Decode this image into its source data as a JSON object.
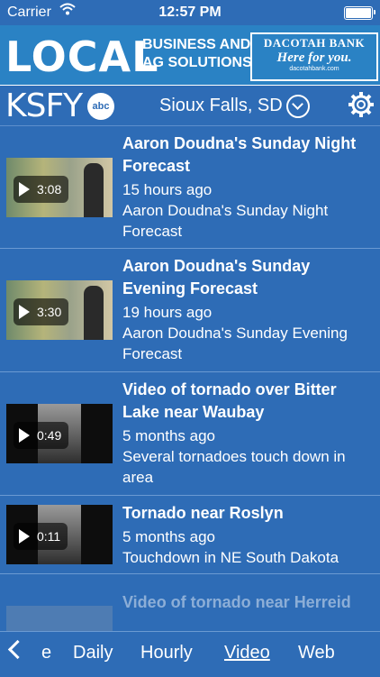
{
  "status": {
    "carrier": "Carrier",
    "time": "12:57 PM"
  },
  "ad": {
    "big": "LOCAL",
    "line1": "BUSINESS AND",
    "line2": "AG SOLUTIONS",
    "bank": "DACOTAH BANK",
    "slogan": "Here for you.",
    "url": "dacotahbank.com"
  },
  "header": {
    "logo": "KSFY",
    "network": "abc",
    "location": "Sioux Falls, SD"
  },
  "videos": [
    {
      "title": "Aaron Doudna's Sunday Night Forecast",
      "age": "15 hours ago",
      "desc": "Aaron Doudna's Sunday Night Forecast",
      "duration": "3:08"
    },
    {
      "title": "Aaron Doudna's Sunday Evening Forecast",
      "age": "19 hours ago",
      "desc": "Aaron Doudna's Sunday Evening Forecast",
      "duration": "3:30"
    },
    {
      "title": "Video of tornado over Bitter Lake near Waubay",
      "age": "5 months ago",
      "desc": "Several tornadoes touch down in area",
      "duration": "0:49"
    },
    {
      "title": "Tornado near Roslyn",
      "age": "5 months ago",
      "desc": "Touchdown in NE South Dakota",
      "duration": "0:11"
    },
    {
      "title": "Video of tornado near Herreid"
    }
  ],
  "tabs": {
    "partial": "e",
    "daily": "Daily",
    "hourly": "Hourly",
    "video": "Video",
    "web": "Web"
  },
  "colors": {
    "background": "#2e6cb6",
    "text": "#ffffff"
  }
}
